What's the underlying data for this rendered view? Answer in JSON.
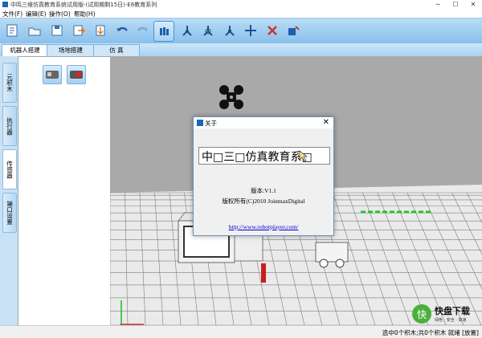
{
  "window": {
    "title": "中鸣三维仿真教育系统试用版-(试用期剩15日)-E6教育系列",
    "minimize": "─",
    "maximize": "☐",
    "close": "✕"
  },
  "menu": {
    "items": [
      "文件(F)",
      "编辑(E)",
      "操作(O)",
      "帮助(H)"
    ]
  },
  "toolbar": {
    "icons": [
      "new-icon",
      "open-icon",
      "save-icon",
      "import-icon",
      "export-icon",
      "undo-icon",
      "redo-icon",
      "select-icon",
      "move-axis-icon",
      "rotate-axis-icon",
      "scale-axis-icon",
      "pan-icon",
      "delete-icon",
      "connect-icon"
    ]
  },
  "tabs": {
    "items": [
      "机器人搭建",
      "场地搭建",
      "仿  真"
    ],
    "active": "机器人搭建"
  },
  "side_tabs": {
    "items": [
      "元积木",
      "执行器",
      "传感器",
      "端口设置"
    ],
    "active": "传感器"
  },
  "palette": {
    "items": [
      "sensor-gray-icon",
      "sensor-red-icon"
    ]
  },
  "status": {
    "text": "选中0个积木;共0个积木 就绪 [放置]"
  },
  "about_dialog": {
    "title": "关于",
    "close": "✕",
    "marquee": "中□三□仿真教育系□",
    "version": "版本:V1.1",
    "copyright": "版权所有(C)2010 JoinmaxDigital",
    "link": "http://www.robotplayer.com/"
  },
  "watermark": {
    "logo_char": "快",
    "name": "快盘下载",
    "tagline": "绿色 · 安全 · 高速"
  },
  "colors": {
    "toolbar_top": "#b9dcf4",
    "toolbar_bottom": "#89c0ec",
    "viewport_bg": "#a9a9a9",
    "grid": "#d9d9d9",
    "accent_red": "#d22020",
    "link": "#0000cc"
  }
}
